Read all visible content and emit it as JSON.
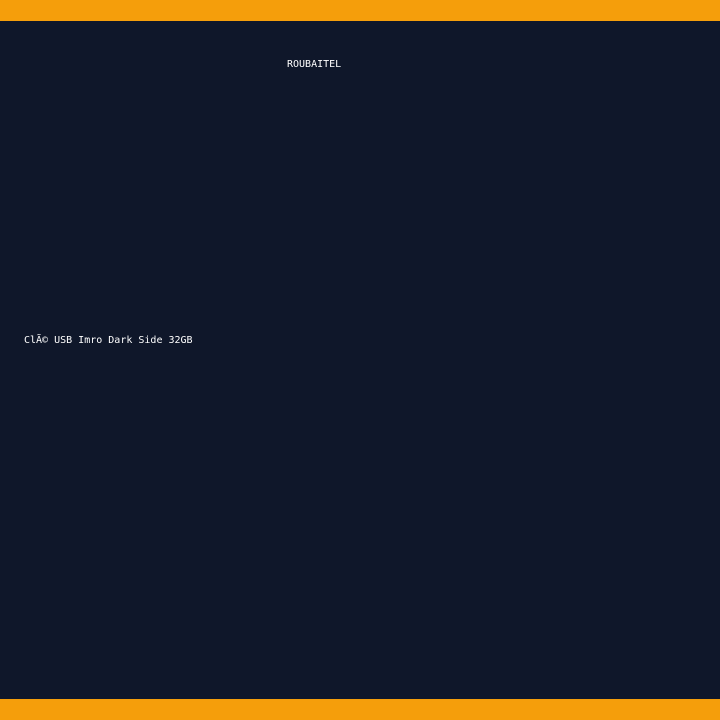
{
  "theme": {
    "background": "#0f172a",
    "accent": "#f59e0b",
    "text": "#ffffff"
  },
  "header": {
    "brand": "ROUBAITEL"
  },
  "product": {
    "title": "ClÃ© USB Imro Dark Side 32GB"
  }
}
